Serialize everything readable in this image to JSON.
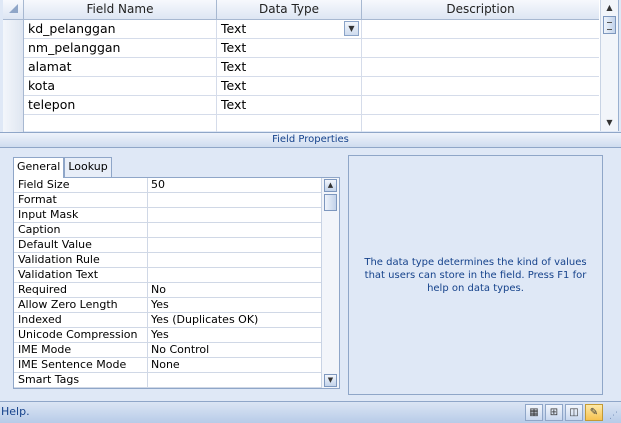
{
  "grid": {
    "columns": {
      "field_name": "Field Name",
      "data_type": "Data Type",
      "description": "Description"
    },
    "rows": [
      {
        "name": "kd_pelanggan",
        "type": "Text",
        "description": ""
      },
      {
        "name": "nm_pelanggan",
        "type": "Text",
        "description": ""
      },
      {
        "name": "alamat",
        "type": "Text",
        "description": ""
      },
      {
        "name": "kota",
        "type": "Text",
        "description": ""
      },
      {
        "name": "telepon",
        "type": "Text",
        "description": ""
      },
      {
        "name": "",
        "type": "",
        "description": ""
      }
    ]
  },
  "field_properties": {
    "title": "Field Properties",
    "tabs": [
      "General",
      "Lookup"
    ],
    "active_tab": "General",
    "properties": [
      {
        "label": "Field Size",
        "value": "50"
      },
      {
        "label": "Format",
        "value": ""
      },
      {
        "label": "Input Mask",
        "value": ""
      },
      {
        "label": "Caption",
        "value": ""
      },
      {
        "label": "Default Value",
        "value": ""
      },
      {
        "label": "Validation Rule",
        "value": ""
      },
      {
        "label": "Validation Text",
        "value": ""
      },
      {
        "label": "Required",
        "value": "No"
      },
      {
        "label": "Allow Zero Length",
        "value": "Yes"
      },
      {
        "label": "Indexed",
        "value": "Yes (Duplicates OK)"
      },
      {
        "label": "Unicode Compression",
        "value": "Yes"
      },
      {
        "label": "IME Mode",
        "value": "No Control"
      },
      {
        "label": "IME Sentence Mode",
        "value": "None"
      },
      {
        "label": "Smart Tags",
        "value": ""
      }
    ],
    "help_text": "The data type determines the kind of values that users can store in the field.  Press F1 for help on data types."
  },
  "status": {
    "text": "Help."
  },
  "colors": {
    "accent": "#15428b",
    "panel": "#dfe8f6",
    "border": "#8fa6c8"
  },
  "icons": {
    "view_buttons": [
      "datasheet-view-icon",
      "pivot-table-view-icon",
      "pivot-chart-view-icon",
      "design-view-icon"
    ],
    "active_view": "design-view-icon"
  }
}
